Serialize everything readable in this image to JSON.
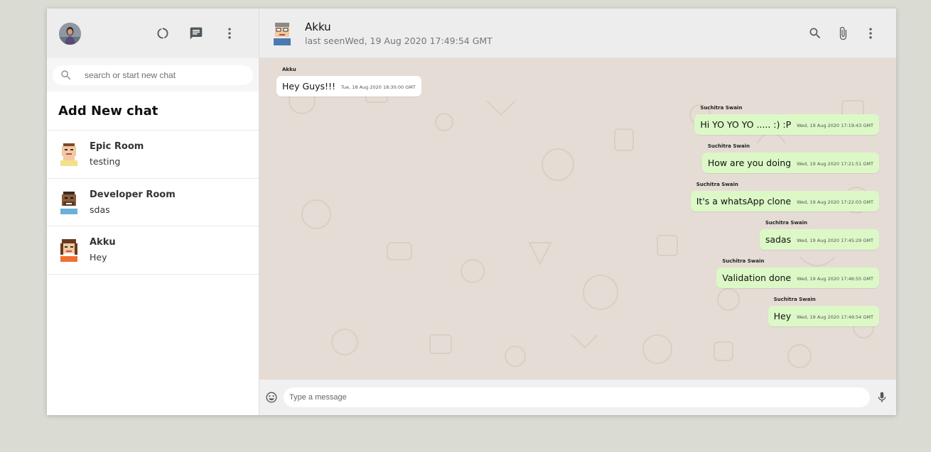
{
  "sidebar": {
    "search_placeholder": "search or start new chat",
    "add_new_chat": "Add New chat",
    "chats": [
      {
        "name": "Epic Room",
        "last": "testing"
      },
      {
        "name": "Developer Room",
        "last": "sdas"
      },
      {
        "name": "Akku",
        "last": "Hey"
      }
    ]
  },
  "chat": {
    "name": "Akku",
    "last_seen": "last seenWed, 19 Aug 2020 17:49:54 GMT",
    "input_placeholder": "Type a message",
    "messages": [
      {
        "sender": "Akku",
        "text": "Hey Guys!!!",
        "time": "Tue, 18 Aug 2020 18:30:00 GMT",
        "type": "received"
      },
      {
        "sender": "Suchitra Swain",
        "text": "Hi YO YO YO ..... :) :P",
        "time": "Wed, 19 Aug 2020 17:19:43 GMT",
        "type": "sent"
      },
      {
        "sender": "Suchitra Swain",
        "text": "How are you doing",
        "time": "Wed, 19 Aug 2020 17:21:51 GMT",
        "type": "sent"
      },
      {
        "sender": "Suchitra Swain",
        "text": "It's a whatsApp clone",
        "time": "Wed, 19 Aug 2020 17:22:03 GMT",
        "type": "sent"
      },
      {
        "sender": "Suchitra Swain",
        "text": "sadas",
        "time": "Wed, 19 Aug 2020 17:45:29 GMT",
        "type": "sent"
      },
      {
        "sender": "Suchitra Swain",
        "text": "Validation done",
        "time": "Wed, 19 Aug 2020 17:46:55 GMT",
        "type": "sent"
      },
      {
        "sender": "Suchitra Swain",
        "text": "Hey",
        "time": "Wed, 19 Aug 2020 17:49:54 GMT",
        "type": "sent"
      }
    ]
  },
  "icons": {
    "sidebar_header": [
      "status-icon",
      "chat-icon",
      "menu-icon"
    ],
    "chat_header": [
      "search-icon",
      "attach-icon",
      "menu-icon"
    ],
    "footer": [
      "emoji-icon",
      "mic-icon"
    ]
  },
  "colors": {
    "header_bg": "#ededed",
    "chat_bg": "#e5ddd5",
    "sent_bubble": "#dcf8c6",
    "received_bubble": "#ffffff",
    "page_bg": "#dadbd3"
  }
}
